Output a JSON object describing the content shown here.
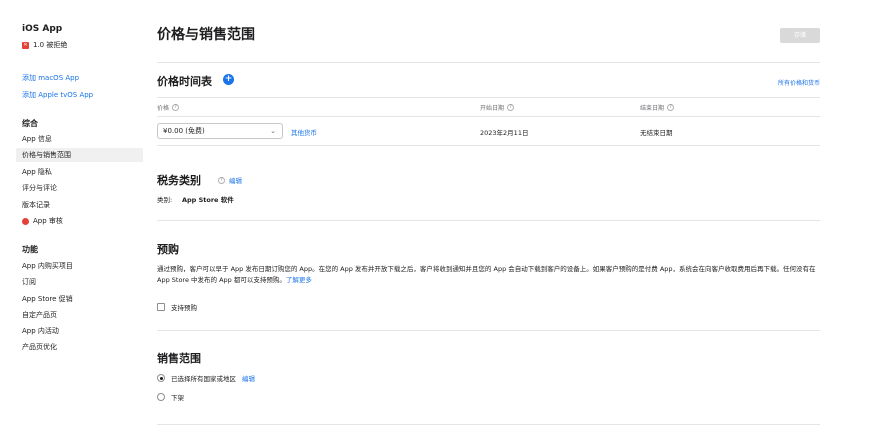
{
  "sidebar": {
    "app_name": "iOS App",
    "version_status": "1.0 被拒绝",
    "add_macos": "添加 macOS App",
    "add_tvos": "添加 Apple tvOS App",
    "general_heading": "综合",
    "general_items": [
      "App 信息",
      "价格与销售范围",
      "App 隐私",
      "评分与评论",
      "版本记录",
      "App 审核"
    ],
    "features_heading": "功能",
    "feature_items": [
      "App 内购买项目",
      "订阅",
      "App Store 促销",
      "自定产品页",
      "App 内活动",
      "产品页优化"
    ]
  },
  "header": {
    "title": "价格与销售范围",
    "save_label": "存储"
  },
  "price_schedule": {
    "title": "价格时间表",
    "all_prices_link": "所有价格和货币",
    "col_price": "价格",
    "col_start": "开始日期",
    "col_end": "结束日期",
    "selected_price": "¥0.00 (免费)",
    "other_currencies": "其他货币",
    "start_date": "2023年2月11日",
    "end_date": "无结束日期"
  },
  "tax": {
    "title": "税务类别",
    "edit": "编辑",
    "category_label": "类别:",
    "category_value": "App Store 软件"
  },
  "preorder": {
    "title": "预购",
    "description": "通过预购，客户可以早于 App 发布日期订购您的 App。在您的 App 发布并开放下载之后，客户将收到通知并且您的 App 会自动下载到客户的设备上。如果客户预购的是付费 App，系统会在向客户收取费用后再下载。任何没有在 App Store 中发布的 App 都可以支持预购。",
    "learn_more": "了解更多",
    "checkbox_label": "支持预购"
  },
  "availability": {
    "title": "销售范围",
    "option_all": "已选择所有国家或地区",
    "edit": "编辑",
    "option_remove": "下架"
  }
}
